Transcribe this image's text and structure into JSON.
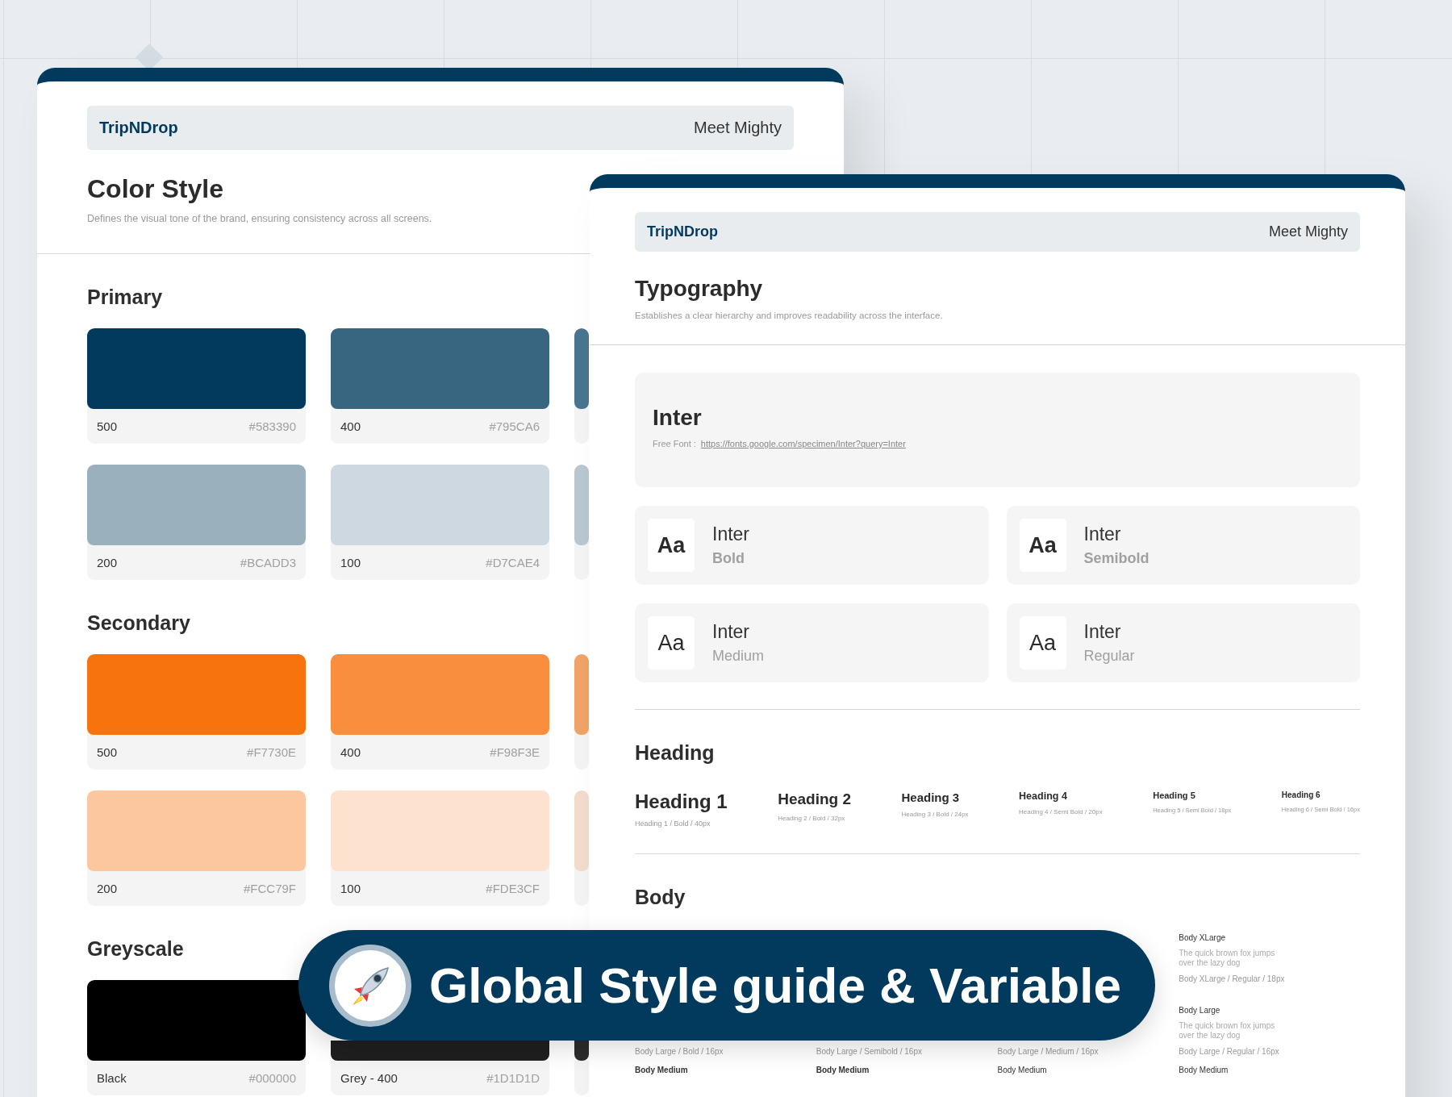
{
  "color_card": {
    "brand": "TripNDrop",
    "link": "Meet Mighty",
    "title": "Color Style",
    "subtitle": "Defines the visual tone of the brand, ensuring consistency across all screens.",
    "groups": [
      {
        "name": "Primary",
        "rows": [
          [
            {
              "shade": "500",
              "hex": "#583390",
              "color": "#023a5e"
            },
            {
              "shade": "400",
              "hex": "#795CA6",
              "color": "#386580"
            },
            {
              "color": "#4a7590"
            }
          ],
          [
            {
              "shade": "200",
              "hex": "#BCADD3",
              "color": "#9bb0bd"
            },
            {
              "shade": "100",
              "hex": "#D7CAE4",
              "color": "#cdd8e0"
            },
            {
              "color": "#b9c7d1"
            }
          ]
        ]
      },
      {
        "name": "Secondary",
        "rows": [
          [
            {
              "shade": "500",
              "hex": "#F7730E",
              "color": "#f7730e"
            },
            {
              "shade": "400",
              "hex": "#F98F3E",
              "color": "#f98f3e"
            },
            {
              "color": "#f0a467"
            }
          ],
          [
            {
              "shade": "200",
              "hex": "#FCC79F",
              "color": "#fcc79f"
            },
            {
              "shade": "100",
              "hex": "#FDE3CF",
              "color": "#fde3cf"
            },
            {
              "color": "#f3dccb"
            }
          ]
        ]
      },
      {
        "name": "Greyscale",
        "rows": [
          [
            {
              "shade": "Black",
              "hex": "#000000",
              "color": "#000000"
            },
            {
              "shade": "Grey - 400",
              "hex": "#1D1D1D",
              "color": "#1f1f1f"
            },
            {
              "color": "#2d2d2d"
            }
          ]
        ]
      }
    ]
  },
  "type_card": {
    "brand": "TripNDrop",
    "link": "Meet Mighty",
    "title": "Typography",
    "subtitle": "Establishes a clear hierarchy and improves readability across the interface.",
    "font": {
      "name": "Inter",
      "label": "Free Font :",
      "url": "https://fonts.google.com/specimen/Inter?query=Inter"
    },
    "weights": [
      {
        "sample": "Aa",
        "name": "Inter",
        "weight": "Bold",
        "kind": "bold"
      },
      {
        "sample": "Aa",
        "name": "Inter",
        "weight": "Semibold",
        "kind": "semibold"
      },
      {
        "sample": "Aa",
        "name": "Inter",
        "weight": "Medium",
        "kind": "medium"
      },
      {
        "sample": "Aa",
        "name": "Inter",
        "weight": "Regular",
        "kind": "regular"
      }
    ],
    "heading": {
      "title": "Heading",
      "items": [
        {
          "label": "Heading 1",
          "meta": "Heading 1 / Bold / 40px",
          "kind": "h1"
        },
        {
          "label": "Heading 2",
          "meta": "Heading 2 / Bold / 32px",
          "kind": "h2"
        },
        {
          "label": "Heading 3",
          "meta": "Heading 3 / Bold / 24px",
          "kind": "h3"
        },
        {
          "label": "Heading 4",
          "meta": "Heading 4 / Semi Bold / 20px",
          "kind": "h4"
        },
        {
          "label": "Heading 5",
          "meta": "Heading 5 / Semi Bold / 18px",
          "kind": "h5"
        },
        {
          "label": "Heading 6",
          "meta": "Heading 6 / Semi Bold / 16px",
          "kind": "h6"
        }
      ]
    },
    "body": {
      "title": "Body",
      "columns": [
        {
          "kind": "bold",
          "blocks": [
            {
              "kind": "large",
              "meta": "Body Large / Bold / 16px"
            },
            {
              "kind": "medium",
              "label": "Body Medium"
            }
          ]
        },
        {
          "kind": "semibold",
          "blocks": [
            {
              "kind": "large",
              "meta": "Body Large / Semibold / 16px"
            },
            {
              "kind": "medium",
              "label": "Body Medium"
            }
          ]
        },
        {
          "kind": "medium",
          "blocks": [
            {
              "kind": "large",
              "meta": "Body Large / Medium / 16px"
            },
            {
              "kind": "medium",
              "label": "Body Medium"
            }
          ]
        },
        {
          "kind": "regular",
          "blocks": [
            {
              "kind": "xlarge",
              "label": "Body XLarge",
              "sample": "The quick brown fox jumps over the lazy dog",
              "meta": "Body XLarge / Regular / 18px"
            },
            {
              "kind": "large",
              "label": "Body Large",
              "sample": "The quick brown fox jumps over the lazy dog",
              "meta": "Body Large / Regular / 16px"
            },
            {
              "kind": "medium",
              "label": "Body Medium"
            }
          ]
        }
      ]
    }
  },
  "banner": {
    "title": "Global Style guide & Variable"
  }
}
